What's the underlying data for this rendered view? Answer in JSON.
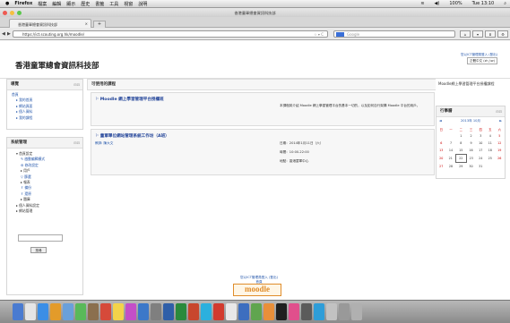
{
  "menubar": {
    "apple": "",
    "app": "Firefox",
    "items": [
      "檔案",
      "編輯",
      "顯示",
      "歷史",
      "書籤",
      "工具",
      "視窗",
      "說明"
    ],
    "status": [
      "100%",
      "Tue 13:10"
    ]
  },
  "window": {
    "title": "香港童軍總會資訊科技部"
  },
  "tab": {
    "title": "香港童軍總會資訊科技部",
    "close": "×",
    "new": "+"
  },
  "navbar": {
    "back": "◀",
    "forward": "▶",
    "url": "https://ict.scouting.org.hk/moodle/",
    "search_placeholder": "Google",
    "btns": [
      "⌂",
      "▾",
      "⬇",
      "⚙"
    ]
  },
  "site": {
    "title": "香港童軍總會資訊科技部",
    "user_line1": "您以ICT管理員登入 (登出)",
    "user_line2": "正體中文 (zh_tw)"
  },
  "nav_block": {
    "title": "導覽",
    "items": [
      "首頁",
      "我的首頁",
      "網站頁面",
      "個人資料",
      "我的課程"
    ]
  },
  "admin_block": {
    "title": "系統管理",
    "items": [
      "首頁設定",
      "啟動編輯模式",
      "修改設定",
      "用戶",
      "篩選",
      "報表",
      "備份",
      "還原",
      "題庫",
      "個人資料設定",
      "網站管理"
    ]
  },
  "main": {
    "title": "可使用的課程",
    "course1": {
      "title": "Moodle 網上學習管理平台授權班",
      "desc": "本課程將介紹 Moodle 網上學習管理平台的基本一切的，以及如何自行架構 Moodle 平台的用戶。"
    },
    "course2": {
      "title": "童軍單位網站管理系統工作坊（A班）",
      "teacher": "教師: 陳大文",
      "date": "日期：2014年1月11日（六）",
      "time": "時間：10:00-22:00",
      "venue": "地點：香港童軍中心"
    }
  },
  "right_top": {
    "title": "Moodle網上學習管理平台授權課程"
  },
  "calendar": {
    "title": "行事曆",
    "month": "2013年 10月",
    "prev": "◄",
    "next": "►",
    "days": [
      "日",
      "一",
      "二",
      "三",
      "四",
      "五",
      "六"
    ],
    "rows": [
      [
        "",
        "",
        "1",
        "2",
        "3",
        "4",
        "5"
      ],
      [
        "6",
        "7",
        "8",
        "9",
        "10",
        "11",
        "12"
      ],
      [
        "13",
        "14",
        "15",
        "16",
        "17",
        "18",
        "19"
      ],
      [
        "20",
        "21",
        "22",
        "23",
        "24",
        "25",
        "26"
      ],
      [
        "27",
        "28",
        "29",
        "30",
        "31",
        "",
        ""
      ]
    ]
  },
  "search": {
    "button": "搜尋"
  },
  "footer": {
    "login": "您以ICT管理員登入 (登出)",
    "home": "首頁",
    "logo": "moodle"
  },
  "colors": {
    "link": "#2255aa",
    "accent": "#e08d2b"
  }
}
